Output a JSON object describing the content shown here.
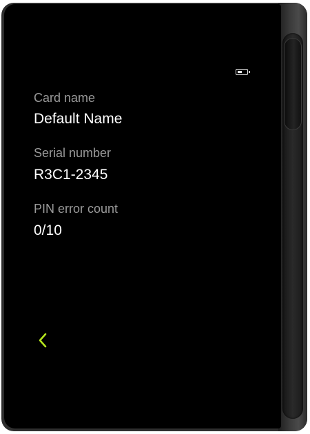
{
  "device": {
    "accent_color": "#b5e61d",
    "status": {
      "battery_icon": "battery-low-icon"
    },
    "fields": [
      {
        "label": "Card name",
        "value": "Default Name"
      },
      {
        "label": "Serial number",
        "value": "R3C1-2345"
      },
      {
        "label": "PIN error count",
        "value": "0/10"
      }
    ],
    "back_icon": "chevron-left-icon"
  }
}
